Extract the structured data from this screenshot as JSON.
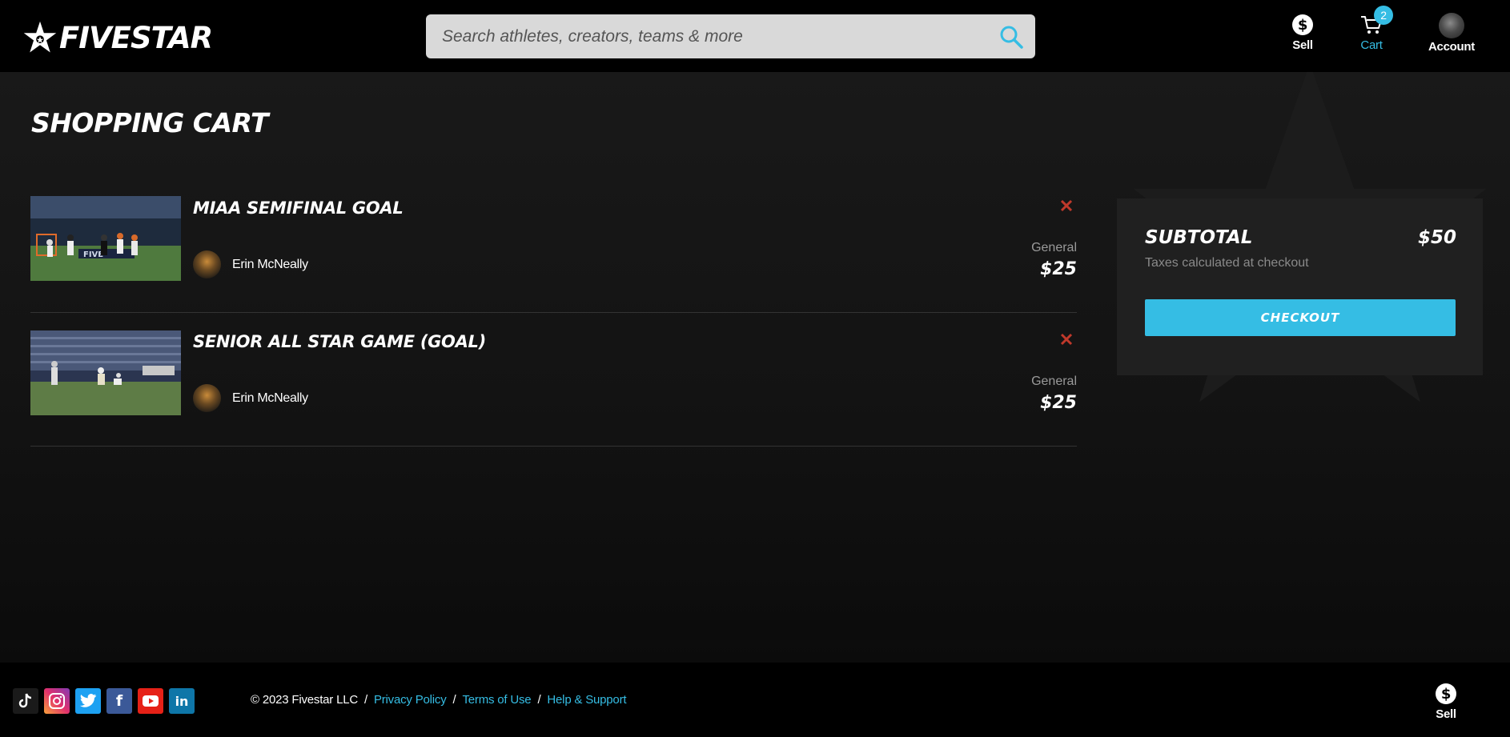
{
  "header": {
    "logo_text": "FIVESTAR",
    "search_placeholder": "Search athletes, creators, teams & more",
    "nav": {
      "sell_label": "Sell",
      "cart_label": "Cart",
      "cart_count": "2",
      "account_label": "Account"
    }
  },
  "page": {
    "title": "SHOPPING CART"
  },
  "cart": {
    "items": [
      {
        "title": "MIAA SEMIFINAL GOAL",
        "creator": "Erin McNeally",
        "license": "General",
        "price": "$25"
      },
      {
        "title": "SENIOR ALL STAR GAME (GOAL)",
        "creator": "Erin McNeally",
        "license": "General",
        "price": "$25"
      }
    ]
  },
  "summary": {
    "subtotal_label": "SUBTOTAL",
    "subtotal_value": "$50",
    "tax_note": "Taxes calculated at checkout",
    "checkout_label": "CHECKOUT"
  },
  "footer": {
    "socials": [
      "tiktok-icon",
      "instagram-icon",
      "twitter-icon",
      "facebook-icon",
      "youtube-icon",
      "linkedin-icon"
    ],
    "copyright": "© 2023 Fivestar LLC",
    "privacy": "Privacy Policy",
    "terms": "Terms of Use",
    "help": "Help & Support",
    "sell_label": "Sell"
  },
  "colors": {
    "accent": "#35bde4",
    "remove": "#c0392b",
    "header_bg": "#000000",
    "summary_bg": "#202020"
  }
}
